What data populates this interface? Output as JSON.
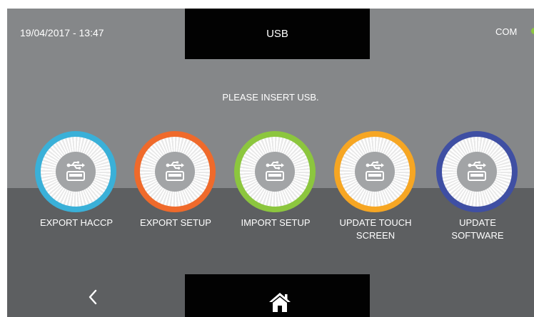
{
  "header": {
    "datetime": "19/04/2017 - 13:47",
    "title": "USB",
    "status_label": "COM",
    "status_color": "#8dc63f"
  },
  "prompt": "PLEASE INSERT USB.",
  "buttons": [
    {
      "label_lines": [
        "EXPORT HACCP"
      ],
      "ring_color": "#3ab0d8",
      "icon": "usb-icon"
    },
    {
      "label_lines": [
        "EXPORT SETUP"
      ],
      "ring_color": "#ef6a2b",
      "icon": "usb-icon"
    },
    {
      "label_lines": [
        "IMPORT SETUP"
      ],
      "ring_color": "#8cc63e",
      "icon": "usb-icon"
    },
    {
      "label_lines": [
        "UPDATE TOUCH",
        "SCREEN"
      ],
      "ring_color": "#f6a623",
      "icon": "usb-icon"
    },
    {
      "label_lines": [
        "UPDATE",
        "SOFTWARE"
      ],
      "ring_color": "#3f4fa3",
      "icon": "usb-icon"
    }
  ],
  "nav": {
    "back_icon": "chevron-left-icon",
    "home_icon": "home-icon"
  },
  "colors": {
    "upper_bg": "#858789",
    "lower_bg": "#5d5f61",
    "title_bg": "#020202"
  }
}
